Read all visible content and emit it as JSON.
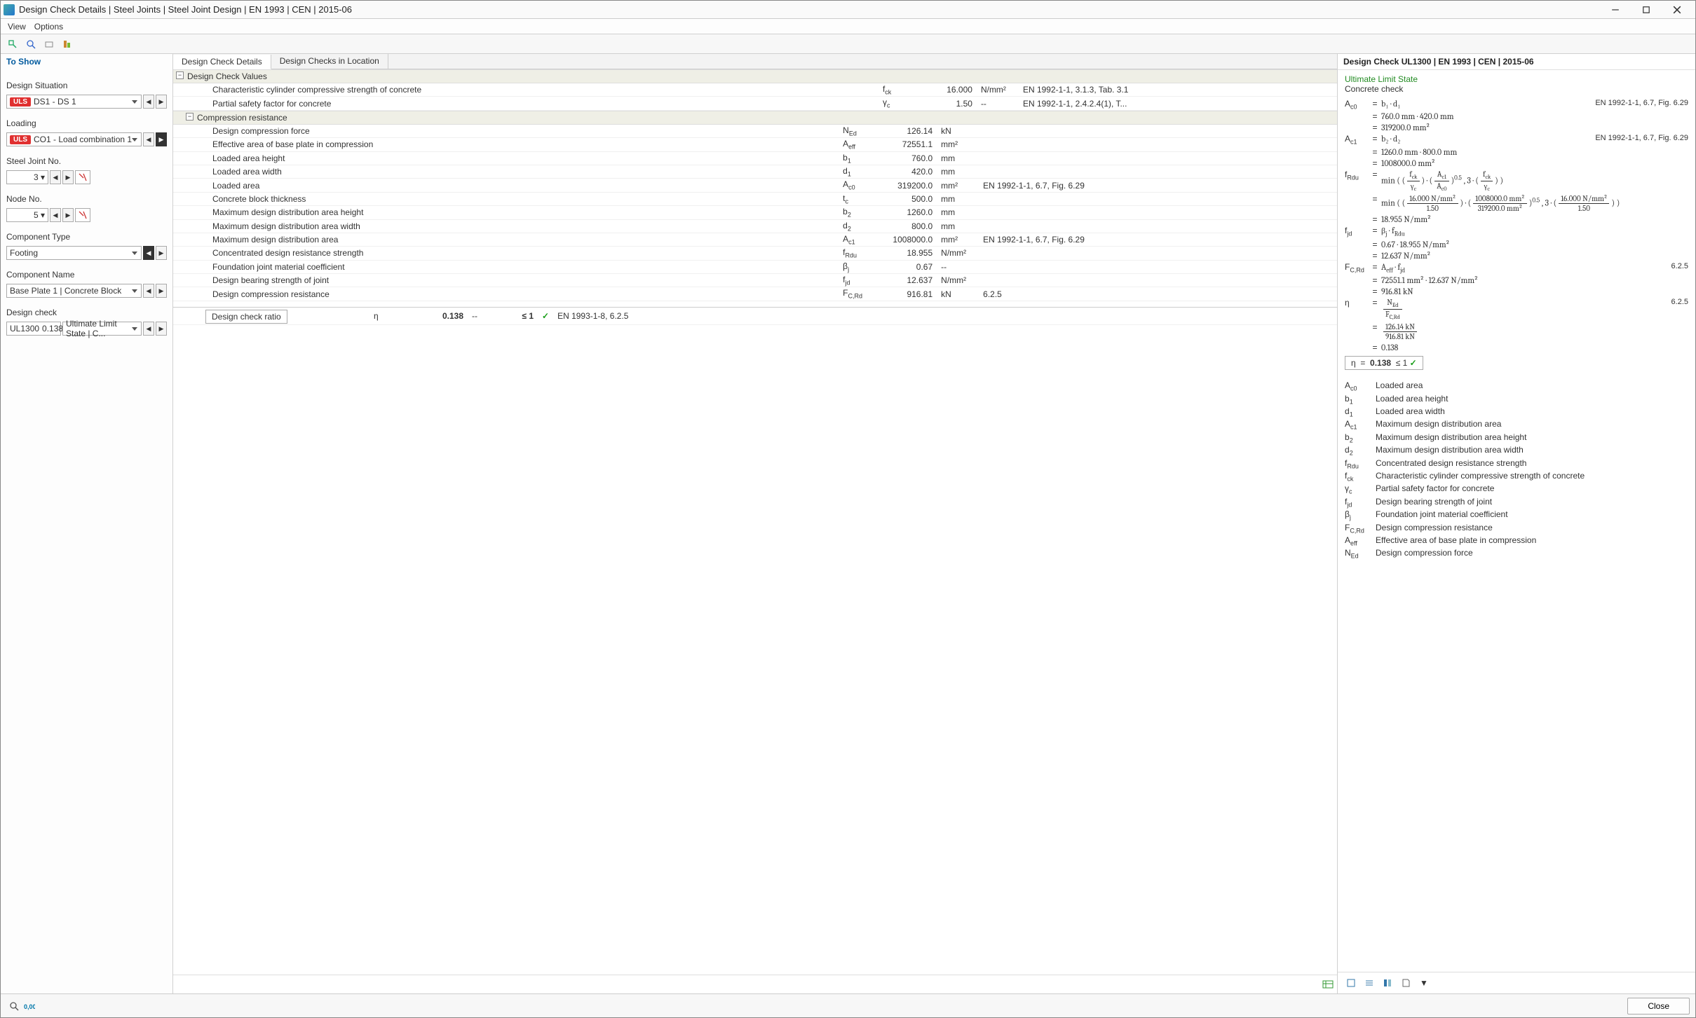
{
  "window": {
    "title": "Design Check Details | Steel Joints | Steel Joint Design | EN 1993 | CEN | 2015-06"
  },
  "menus": {
    "view": "View",
    "options": "Options"
  },
  "left": {
    "panel_title": "To Show",
    "design_situation_label": "Design Situation",
    "design_situation_tag": "ULS",
    "design_situation_value": "DS1 - DS 1",
    "loading_label": "Loading",
    "loading_tag": "ULS",
    "loading_value": "CO1 - Load combination 1",
    "steel_joint_label": "Steel Joint No.",
    "steel_joint_value": "3",
    "node_label": "Node No.",
    "node_value": "5",
    "component_type_label": "Component Type",
    "component_type_value": "Footing",
    "component_name_label": "Component Name",
    "component_name_value": "Base Plate 1 | Concrete Block",
    "design_check_label": "Design check",
    "design_check_code": "UL1300",
    "design_check_ratio": "0.138",
    "design_check_value": "Ultimate Limit State | C..."
  },
  "center": {
    "tabs": {
      "details": "Design Check Details",
      "location": "Design Checks in Location"
    },
    "group1_label": "Design Check Values",
    "rows_top": [
      {
        "desc": "Characteristic cylinder compressive strength of concrete",
        "sym": "f_ck",
        "val": "16.000",
        "unit": "N/mm²",
        "ref": "EN 1992-1-1, 3.1.3, Tab. 3.1"
      },
      {
        "desc": "Partial safety factor for concrete",
        "sym": "γ_c",
        "val": "1.50",
        "unit": "--",
        "ref": "EN 1992-1-1, 2.4.2.4(1), T..."
      }
    ],
    "group2_label": "Compression resistance",
    "rows_comp": [
      {
        "desc": "Design compression force",
        "sym": "N_Ed",
        "val": "126.14",
        "unit": "kN",
        "ref": ""
      },
      {
        "desc": "Effective area of base plate in compression",
        "sym": "A_eff",
        "val": "72551.1",
        "unit": "mm²",
        "ref": ""
      },
      {
        "desc": "Loaded area height",
        "sym": "b_1",
        "val": "760.0",
        "unit": "mm",
        "ref": ""
      },
      {
        "desc": "Loaded area width",
        "sym": "d_1",
        "val": "420.0",
        "unit": "mm",
        "ref": ""
      },
      {
        "desc": "Loaded area",
        "sym": "A_c0",
        "val": "319200.0",
        "unit": "mm²",
        "ref": "EN 1992-1-1, 6.7, Fig. 6.29"
      },
      {
        "desc": "Concrete block thickness",
        "sym": "t_c",
        "val": "500.0",
        "unit": "mm",
        "ref": ""
      },
      {
        "desc": "Maximum design distribution area height",
        "sym": "b_2",
        "val": "1260.0",
        "unit": "mm",
        "ref": ""
      },
      {
        "desc": "Maximum design distribution area width",
        "sym": "d_2",
        "val": "800.0",
        "unit": "mm",
        "ref": ""
      },
      {
        "desc": "Maximum design distribution area",
        "sym": "A_c1",
        "val": "1008000.0",
        "unit": "mm²",
        "ref": "EN 1992-1-1, 6.7, Fig. 6.29"
      },
      {
        "desc": "Concentrated design resistance strength",
        "sym": "f_Rdu",
        "val": "18.955",
        "unit": "N/mm²",
        "ref": ""
      },
      {
        "desc": "Foundation joint material coefficient",
        "sym": "β_j",
        "val": "0.67",
        "unit": "--",
        "ref": ""
      },
      {
        "desc": "Design bearing strength of joint",
        "sym": "f_jd",
        "val": "12.637",
        "unit": "N/mm²",
        "ref": ""
      },
      {
        "desc": "Design compression resistance",
        "sym": "F_C,Rd",
        "val": "916.81",
        "unit": "kN",
        "ref": "6.2.5"
      }
    ],
    "ratio_label": "Design check ratio",
    "ratio_sym": "η",
    "ratio_val": "0.138",
    "ratio_unit": "--",
    "ratio_limit": "≤ 1",
    "ratio_ref": "EN 1993-1-8, 6.2.5"
  },
  "right": {
    "title": "Design Check UL1300 | EN 1993 | CEN | 2015-06",
    "subtitle": "Ultimate Limit State",
    "subtitle2": "Concrete check",
    "lines": {
      "ac0_1": "b₁  ·  d₁",
      "ac0_2": "760.0 mm  ·  420.0 mm",
      "ac0_3": "319200.0 mm²",
      "ac0_ref": "EN 1992-1-1, 6.7, Fig. 6.29",
      "ac1_1": "b₂  ·  d₂",
      "ac1_2": "1260.0 mm  ·  800.0 mm",
      "ac1_3": "1008000.0 mm²",
      "ac1_ref": "EN 1992-1-1, 6.7, Fig. 6.29",
      "frdu_3": "18.955 N/mm²",
      "fjd_1": "β_j  ·  f_Rdu",
      "fjd_2": "0.67  ·  18.955 N/mm²",
      "fjd_3": "12.637 N/mm²",
      "fcrd_1": "A_eff  ·  f_jd",
      "fcrd_2": "72551.1 mm²  ·  12.637 N/mm²",
      "fcrd_3": "916.81 kN",
      "fcrd_ref": "6.2.5",
      "eta_ref": "6.2.5",
      "eta_4": "0.138",
      "eta_result": "η    =    0.138   ≤ 1 ✓"
    },
    "legend": [
      {
        "sym": "A_c0",
        "txt": "Loaded area"
      },
      {
        "sym": "b_1",
        "txt": "Loaded area height"
      },
      {
        "sym": "d_1",
        "txt": "Loaded area width"
      },
      {
        "sym": "A_c1",
        "txt": "Maximum design distribution area"
      },
      {
        "sym": "b_2",
        "txt": "Maximum design distribution area height"
      },
      {
        "sym": "d_2",
        "txt": "Maximum design distribution area width"
      },
      {
        "sym": "f_Rdu",
        "txt": "Concentrated design resistance strength"
      },
      {
        "sym": "f_ck",
        "txt": "Characteristic cylinder compressive strength of concrete"
      },
      {
        "sym": "γ_c",
        "txt": "Partial safety factor for concrete"
      },
      {
        "sym": "f_jd",
        "txt": "Design bearing strength of joint"
      },
      {
        "sym": "β_j",
        "txt": "Foundation joint material coefficient"
      },
      {
        "sym": "F_C,Rd",
        "txt": "Design compression resistance"
      },
      {
        "sym": "A_eff",
        "txt": "Effective area of base plate in compression"
      },
      {
        "sym": "N_Ed",
        "txt": "Design compression force"
      }
    ]
  },
  "footer": {
    "close": "Close"
  }
}
